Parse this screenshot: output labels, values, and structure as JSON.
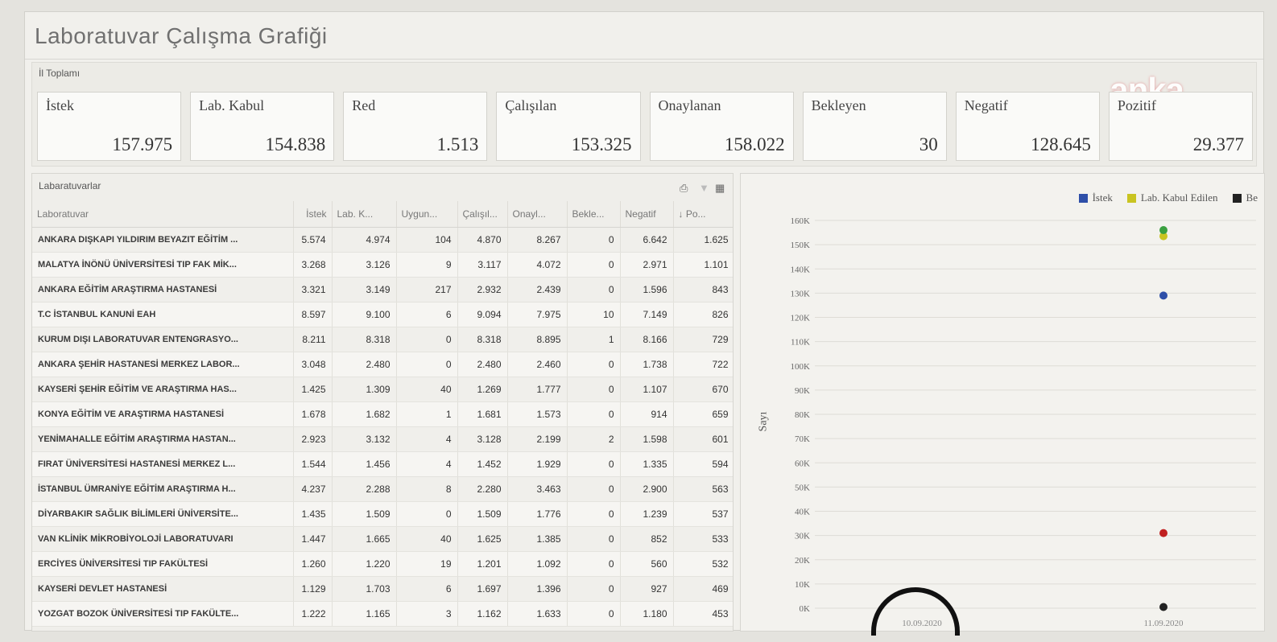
{
  "page": {
    "title": "Laboratuvar Çalışma Grafiği"
  },
  "watermark": "anka",
  "totals": {
    "label": "İl Toplamı",
    "cards": [
      {
        "label": "İstek",
        "value": "157.975"
      },
      {
        "label": "Lab. Kabul",
        "value": "154.838"
      },
      {
        "label": "Red",
        "value": "1.513"
      },
      {
        "label": "Çalışılan",
        "value": "153.325"
      },
      {
        "label": "Onaylanan",
        "value": "158.022"
      },
      {
        "label": "Bekleyen",
        "value": "30"
      },
      {
        "label": "Negatif",
        "value": "128.645"
      },
      {
        "label": "Pozitif",
        "value": "29.377"
      }
    ]
  },
  "labs": {
    "title": "Labaratuvarlar",
    "columns": [
      "Laboratuvar",
      "İstek",
      "Lab. K...",
      "Uygun...",
      "Çalışıl...",
      "Onayl...",
      "Bekle...",
      "Negatif",
      "↓ Po..."
    ],
    "rows": [
      [
        "ANKARA DIŞKAPI YILDIRIM BEYAZIT EĞİTİM ...",
        "5.574",
        "4.974",
        "104",
        "4.870",
        "8.267",
        "0",
        "6.642",
        "1.625"
      ],
      [
        "MALATYA İNÖNÜ ÜNİVERSİTESİ TIP FAK MİK...",
        "3.268",
        "3.126",
        "9",
        "3.117",
        "4.072",
        "0",
        "2.971",
        "1.101"
      ],
      [
        "ANKARA EĞİTİM ARAŞTIRMA HASTANESİ",
        "3.321",
        "3.149",
        "217",
        "2.932",
        "2.439",
        "0",
        "1.596",
        "843"
      ],
      [
        "T.C İSTANBUL KANUNİ EAH",
        "8.597",
        "9.100",
        "6",
        "9.094",
        "7.975",
        "10",
        "7.149",
        "826"
      ],
      [
        "KURUM DIŞI LABORATUVAR ENTENGRASYO...",
        "8.211",
        "8.318",
        "0",
        "8.318",
        "8.895",
        "1",
        "8.166",
        "729"
      ],
      [
        "ANKARA ŞEHİR HASTANESİ MERKEZ LABOR...",
        "3.048",
        "2.480",
        "0",
        "2.480",
        "2.460",
        "0",
        "1.738",
        "722"
      ],
      [
        "KAYSERİ ŞEHİR EĞİTİM VE ARAŞTIRMA HAS...",
        "1.425",
        "1.309",
        "40",
        "1.269",
        "1.777",
        "0",
        "1.107",
        "670"
      ],
      [
        "KONYA EĞİTİM VE ARAŞTIRMA HASTANESİ",
        "1.678",
        "1.682",
        "1",
        "1.681",
        "1.573",
        "0",
        "914",
        "659"
      ],
      [
        "YENİMAHALLE EĞİTİM ARAŞTIRMA HASTAN...",
        "2.923",
        "3.132",
        "4",
        "3.128",
        "2.199",
        "2",
        "1.598",
        "601"
      ],
      [
        "FIRAT ÜNİVERSİTESİ HASTANESİ MERKEZ L...",
        "1.544",
        "1.456",
        "4",
        "1.452",
        "1.929",
        "0",
        "1.335",
        "594"
      ],
      [
        "İSTANBUL ÜMRANİYE EĞİTİM ARAŞTIRMA H...",
        "4.237",
        "2.288",
        "8",
        "2.280",
        "3.463",
        "0",
        "2.900",
        "563"
      ],
      [
        "DİYARBAKIR SAĞLIK BİLİMLERİ ÜNİVERSİTE...",
        "1.435",
        "1.509",
        "0",
        "1.509",
        "1.776",
        "0",
        "1.239",
        "537"
      ],
      [
        "VAN KLİNİK MİKROBİYOLOJİ LABORATUVARI",
        "1.447",
        "1.665",
        "40",
        "1.625",
        "1.385",
        "0",
        "852",
        "533"
      ],
      [
        "ERCİYES ÜNİVERSİTESİ TIP FAKÜLTESİ",
        "1.260",
        "1.220",
        "19",
        "1.201",
        "1.092",
        "0",
        "560",
        "532"
      ],
      [
        "KAYSERİ DEVLET HASTANESİ",
        "1.129",
        "1.703",
        "6",
        "1.697",
        "1.396",
        "0",
        "927",
        "469"
      ],
      [
        "YOZGAT BOZOK ÜNİVERSİTESİ TIP FAKÜLTE...",
        "1.222",
        "1.165",
        "3",
        "1.162",
        "1.633",
        "0",
        "1.180",
        "453"
      ]
    ]
  },
  "chart_data": {
    "type": "scatter",
    "ylabel": "Sayı",
    "ylim": [
      0,
      160000
    ],
    "yticks": [
      "0K",
      "10K",
      "20K",
      "30K",
      "40K",
      "50K",
      "60K",
      "70K",
      "80K",
      "90K",
      "100K",
      "110K",
      "120K",
      "130K",
      "140K",
      "150K",
      "160K"
    ],
    "x_labels": [
      "10.09.2020",
      "11.09.2020"
    ],
    "legend_placement": "top-right",
    "series": [
      {
        "name": "İstek",
        "color": "#2e4fa8",
        "points": [
          {
            "x": "11.09.2020",
            "y": 129000
          }
        ]
      },
      {
        "name": "Lab. Kabul Edilen",
        "color": "#c9c421",
        "points": [
          {
            "x": "11.09.2020",
            "y": 153500
          }
        ]
      },
      {
        "name": "Be",
        "color": "#222222",
        "points": [
          {
            "x": "11.09.2020",
            "y": 500
          }
        ]
      }
    ],
    "extra_points": [
      {
        "color": "#3aa040",
        "x": "11.09.2020",
        "y": 156000
      },
      {
        "color": "#c02020",
        "x": "11.09.2020",
        "y": 31000
      }
    ]
  }
}
